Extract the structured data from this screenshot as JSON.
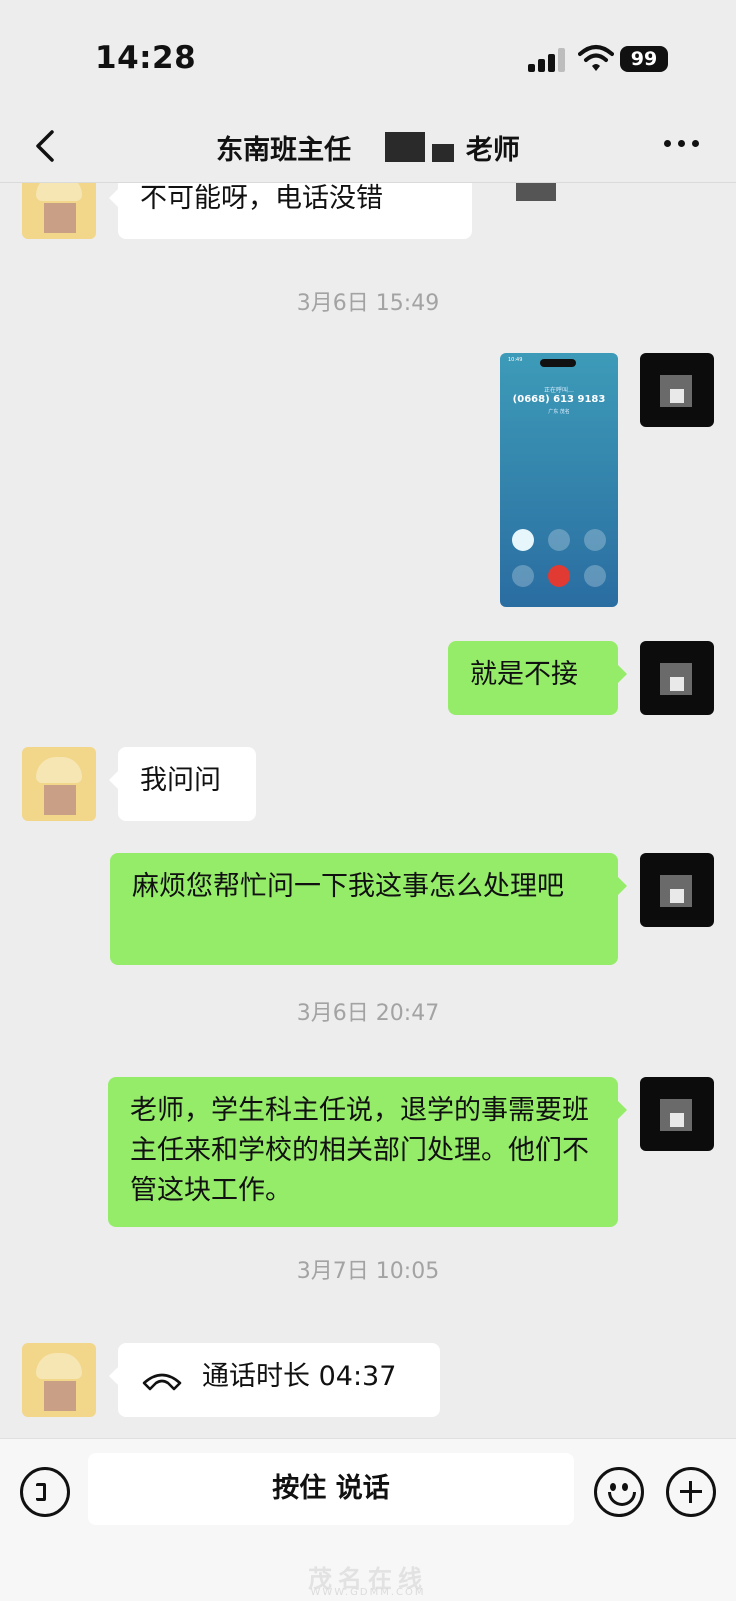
{
  "status_bar": {
    "time": "14:28",
    "battery": "99"
  },
  "header": {
    "title_left": "东南班主任",
    "title_right": "老师"
  },
  "messages": [
    {
      "side": "left",
      "text": "不可能呀，电话没错"
    },
    {
      "timestamp": "3月6日 15:49"
    },
    {
      "side": "right",
      "type": "image",
      "phone": {
        "calling_label": "正在呼叫…",
        "number": "(0668) 613 9183",
        "location": "广东 茂名"
      }
    },
    {
      "side": "right",
      "text": "就是不接"
    },
    {
      "side": "left",
      "text": "我问问"
    },
    {
      "side": "right",
      "text": "麻烦您帮忙问一下我这事怎么处理吧"
    },
    {
      "timestamp": "3月6日 20:47"
    },
    {
      "side": "right",
      "text": "老师，学生科主任说，退学的事需要班主任来和学校的相关部门处理。他们不管这块工作。"
    },
    {
      "timestamp": "3月7日 10:05"
    },
    {
      "side": "left",
      "type": "call",
      "text": "通话时长 04:37"
    }
  ],
  "input_bar": {
    "hold_to_talk": "按住 说话"
  },
  "watermark": {
    "text": "茂名在线",
    "url": "WWW.GDMM.COM"
  },
  "icons": [
    "back-icon",
    "more-icon",
    "voice-icon",
    "emoji-icon",
    "plus-icon",
    "phone-hangup-icon"
  ],
  "colors": {
    "sent_bubble": "#95ec69",
    "received_bubble": "#ffffff",
    "background": "#ededed"
  }
}
